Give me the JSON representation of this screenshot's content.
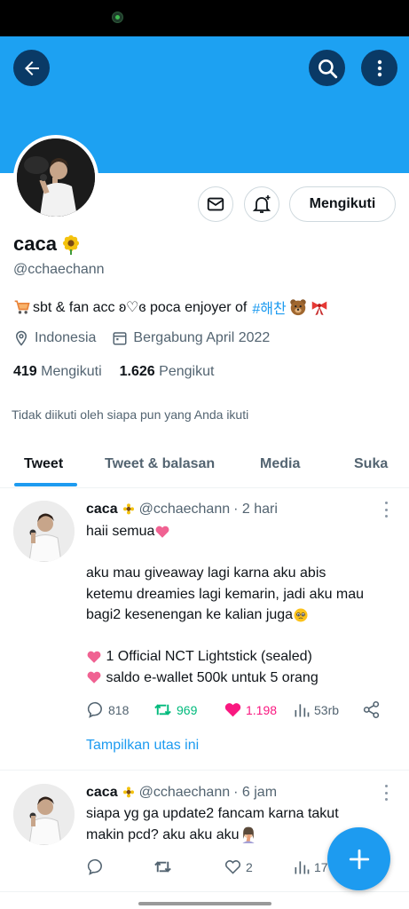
{
  "profile": {
    "name": "caca",
    "handle": "@cchaechann",
    "bio_text": "sbt & fan acc ʚ♡ɞ poca enjoyer of",
    "bio_hashtag": "#해찬",
    "location": "Indonesia",
    "joined": "Bergabung April 2022",
    "following_count": "419",
    "following_label": "Mengikuti",
    "followers_count": "1.626",
    "followers_label": "Pengikut",
    "follow_button": "Mengikuti",
    "not_followed_note": "Tidak diikuti oleh siapa pun yang Anda ikuti"
  },
  "tabs": [
    {
      "label": "Tweet",
      "active": true
    },
    {
      "label": "Tweet & balasan",
      "active": false
    },
    {
      "label": "Media",
      "active": false
    },
    {
      "label": "Suka",
      "active": false
    }
  ],
  "tweets": [
    {
      "name": "caca",
      "handle": "@cchaechann",
      "time": "· 2 hari",
      "lines": [
        "haii semua",
        "",
        "aku mau giveaway lagi karna aku abis",
        "ketemu dreamies lagi kemarin, jadi aku mau",
        "bagi2 kesenengan ke kalian juga",
        "",
        "1 Official NCT Lightstick (sealed)",
        "saldo e-wallet 500k untuk 5 orang"
      ],
      "replies": "818",
      "retweets": "969",
      "likes": "1.198",
      "views": "53rb",
      "show_thread": "Tampilkan utas ini"
    },
    {
      "name": "caca",
      "handle": "@cchaechann",
      "time": "· 6 jam",
      "lines": [
        "siapa yg ga update2 fancam karna takut",
        "makin pcd? aku aku aku"
      ],
      "replies": "",
      "retweets": "",
      "likes": "2",
      "views": "17"
    }
  ],
  "colors": {
    "banner": "#1da1f2",
    "accent": "#1d9bf0",
    "retweet": "#00ba7c",
    "like": "#f91880"
  }
}
